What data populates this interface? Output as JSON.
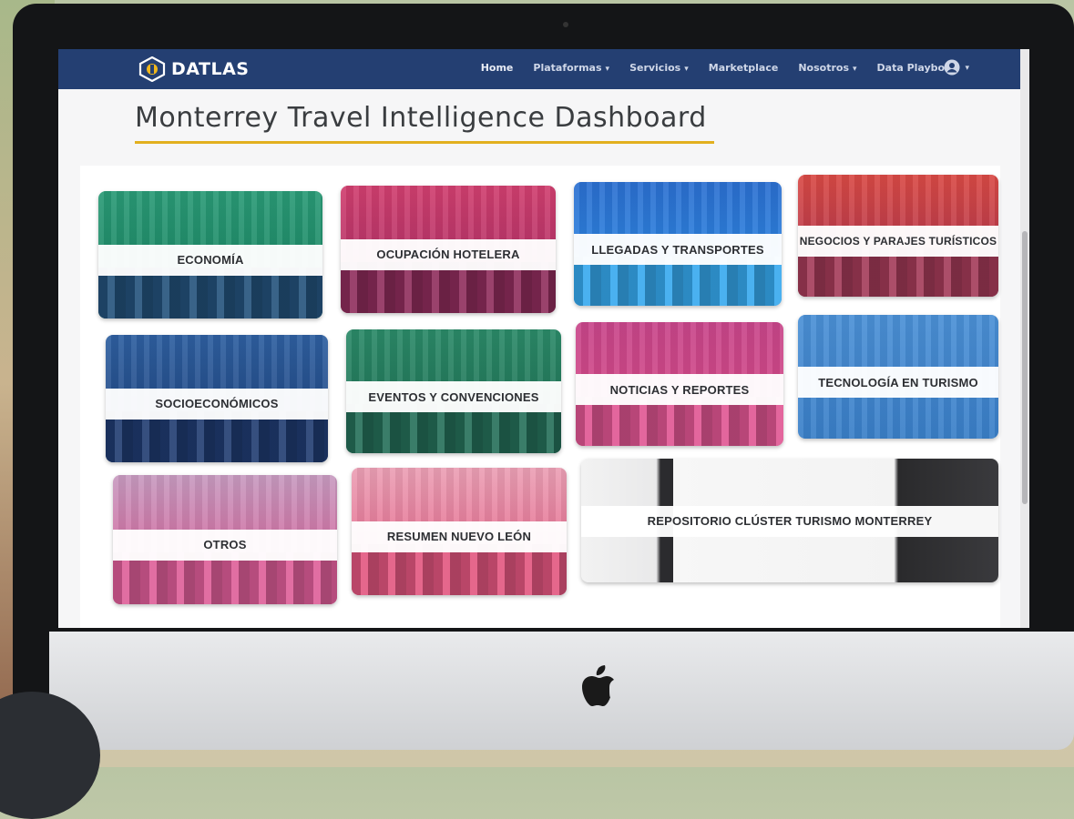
{
  "navbar": {
    "brand": "DATLAS",
    "items": [
      {
        "label": "Home",
        "caret": false
      },
      {
        "label": "Plataformas",
        "caret": true
      },
      {
        "label": "Servicios",
        "caret": true
      },
      {
        "label": "Marketplace",
        "caret": false
      },
      {
        "label": "Nosotros",
        "caret": true
      },
      {
        "label": "Data Playbook",
        "caret": false
      }
    ],
    "user_icon": "user-circle-icon"
  },
  "page": {
    "title": "Monterrey Travel Intelligence Dashboard"
  },
  "tiles": [
    {
      "label": "ECONOMÍA",
      "color": "#1f8a6e"
    },
    {
      "label": "OCUPACIÓN HOTELERA",
      "color": "#c3366a"
    },
    {
      "label": "LLEGADAS Y TRANSPORTES",
      "color": "#2f7ed6"
    },
    {
      "label": "NEGOCIOS Y PARAJES TURÍSTICOS",
      "color": "#b8304a"
    },
    {
      "label": "SOCIOECONÓMICOS",
      "color": "#25508f"
    },
    {
      "label": "EVENTOS Y CONVENCIONES",
      "color": "#1f7a5c"
    },
    {
      "label": "NOTICIAS Y REPORTES",
      "color": "#c24283"
    },
    {
      "label": "TECNOLOGÍA EN TURISMO",
      "color": "#3d86cf"
    },
    {
      "label": "OTROS",
      "color": "#d2558f"
    },
    {
      "label": "RESUMEN NUEVO LEÓN",
      "color": "#e05a82"
    },
    {
      "label": "REPOSITORIO CLÚSTER TURISMO MONTERREY",
      "color": "#e8e8e8"
    }
  ],
  "colors": {
    "navbar_bg": "#243f72",
    "title_underline": "#e2b01f"
  }
}
